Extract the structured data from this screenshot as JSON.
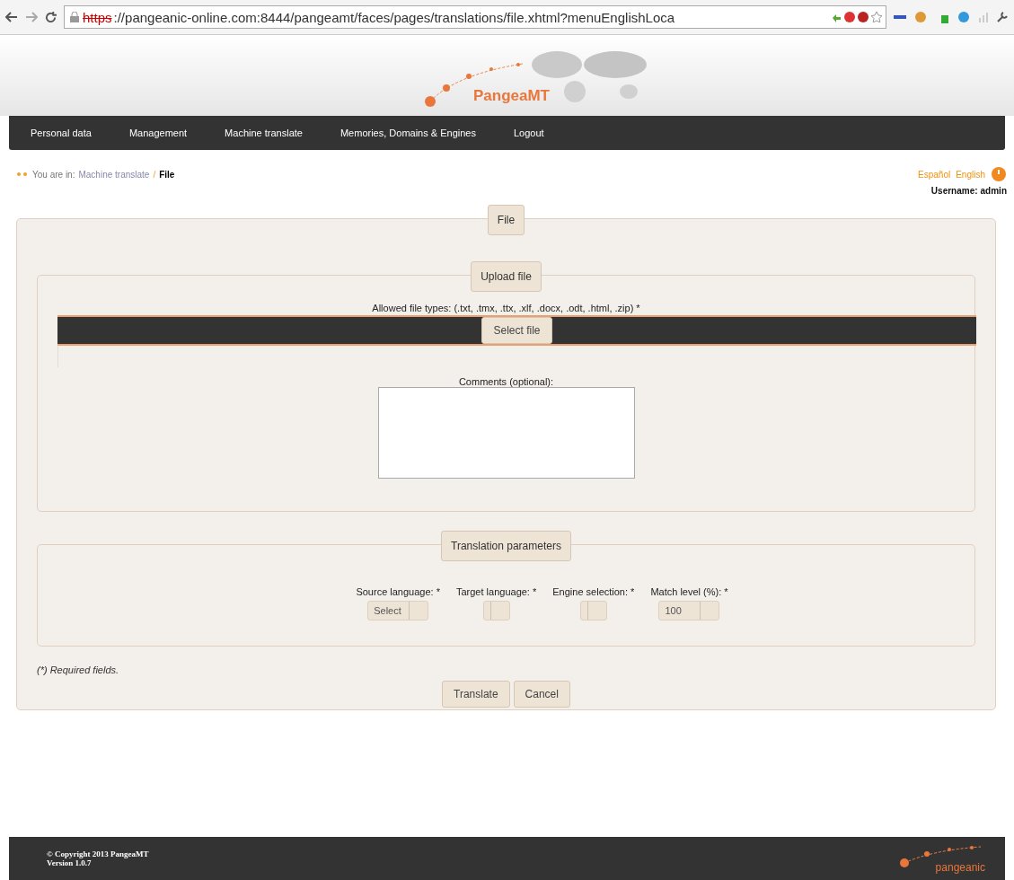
{
  "browser": {
    "url_scheme": "https",
    "url_rest": "://pangeanic-online.com:8444/pangeamt/faces/pages/translations/file.xhtml?menuEnglishLoca"
  },
  "header": {
    "logo": "PangeaMT"
  },
  "nav": [
    {
      "label": "Personal data"
    },
    {
      "label": "Management"
    },
    {
      "label": "Machine translate"
    },
    {
      "label": "Memories, Domains & Engines"
    },
    {
      "label": "Logout"
    }
  ],
  "breadcrumb": {
    "prefix": "You are in:",
    "link": "Machine translate",
    "separator": "/",
    "current": "File"
  },
  "languages": [
    "Español",
    "English"
  ],
  "user": {
    "label": "Username:",
    "name": "admin"
  },
  "form": {
    "legend": "File",
    "upload": {
      "legend": "Upload file",
      "allowed": "Allowed file types: (.txt, .tmx, .ttx, .xlf, .docx, .odt, .html, .zip) *",
      "select_button": "Select file",
      "comments_label": "Comments (optional):"
    },
    "params": {
      "legend": "Translation parameters",
      "fields": [
        {
          "label": "Source language: *",
          "value": "Select"
        },
        {
          "label": "Target language: *"
        },
        {
          "label": "Engine selection: *"
        },
        {
          "label": "Match level (%): *",
          "value": "100"
        }
      ]
    },
    "required_note": "(*) Required fields.",
    "buttons": [
      "Translate",
      "Cancel"
    ]
  },
  "footer": {
    "copyright": "© Copyright 2013 PangeaMT",
    "version": "Version 1.0.7",
    "logo": "pangeanic"
  }
}
